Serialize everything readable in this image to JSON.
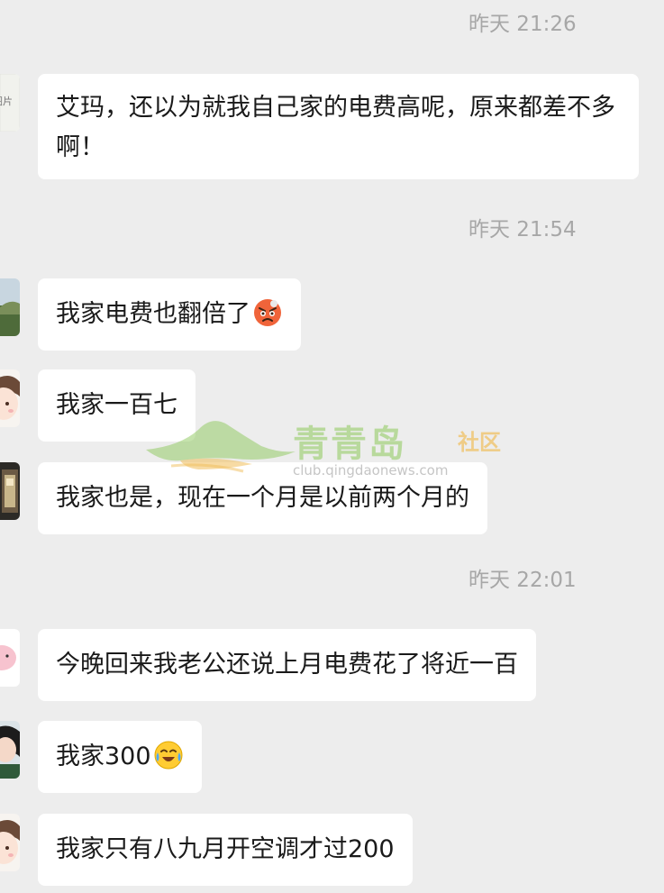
{
  "messages": [
    {
      "kind": "timestamp",
      "text": "昨天 21:26"
    },
    {
      "kind": "bubble",
      "avatar": "avatar-image-partial",
      "text": "艾玛，还以为就我自己家的电费高呢，原来都差不多啊！"
    },
    {
      "kind": "timestamp",
      "text": "昨天 21:54"
    },
    {
      "kind": "bubble",
      "avatar": "avatar-landscape",
      "text": "我家电费也翻倍了",
      "emoji": "angry-face-emoji"
    },
    {
      "kind": "bubble",
      "avatar": "avatar-cartoon-girl",
      "text": "我家一百七"
    },
    {
      "kind": "bubble",
      "avatar": "avatar-dark-photo",
      "text": "我家也是，现在一个月是以前两个月的"
    },
    {
      "kind": "timestamp",
      "text": "昨天 22:01"
    },
    {
      "kind": "bubble",
      "avatar": "avatar-pink",
      "text": "今晚回来我老公还说上月电费花了将近一百"
    },
    {
      "kind": "bubble",
      "avatar": "avatar-woman-photo",
      "text": "我家300",
      "emoji": "laughing-crying-emoji"
    },
    {
      "kind": "bubble",
      "avatar": "avatar-cartoon-girl",
      "text": "我家只有八九月开空调才过200"
    }
  ],
  "avatar_fragment_text": "图片",
  "watermark": {
    "brand": "青青岛",
    "tag": "社区",
    "url": "club.qingdaonews.com"
  },
  "colors": {
    "background": "#ededed",
    "bubble": "#ffffff",
    "timestamp": "#a7a7a7",
    "text": "#1a1a1a",
    "watermark_green": "#8cc85a",
    "watermark_orange": "#f0be5a"
  }
}
